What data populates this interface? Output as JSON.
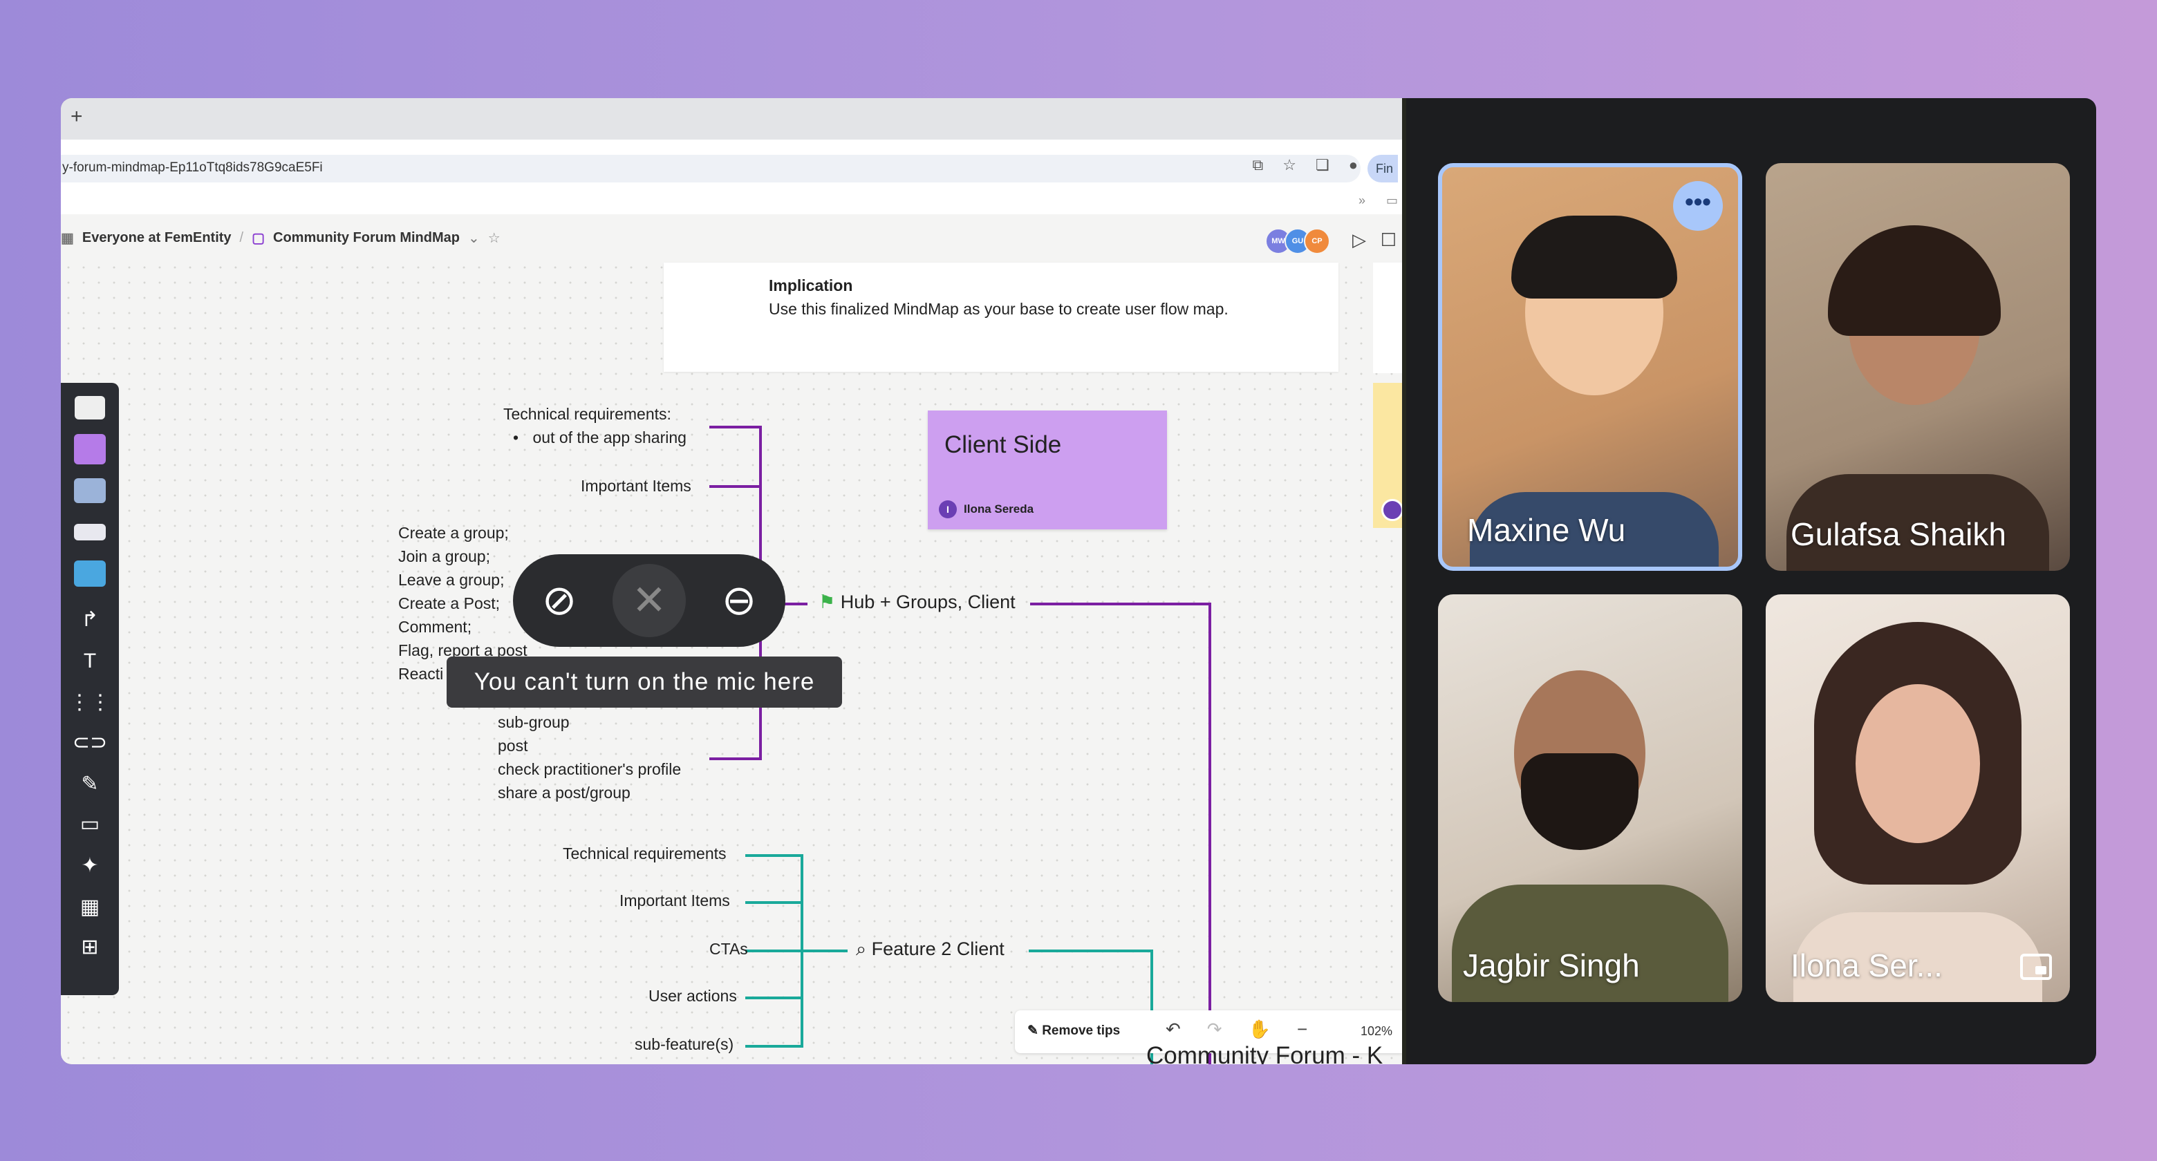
{
  "browser": {
    "new_tab": "+",
    "url": "y-forum-mindmap-Ep11oTtq8ids78G9caE5Fi",
    "profile_label": "Fin"
  },
  "header": {
    "workspace": "Everyone at FemEntity",
    "board": "Community Forum MindMap",
    "avatars": [
      "MW",
      "GU",
      "CP"
    ]
  },
  "info_card": {
    "title": "Implication",
    "text": "Use this finalized MindMap as your base to create user flow map."
  },
  "sticky": {
    "title": "Client Side",
    "author": "Ilona Sereda",
    "author_initial": "I"
  },
  "mindmap": {
    "group1": {
      "tech_req": "Technical requirements:",
      "tech_bullet": "out of the app sharing",
      "important": "Important Items",
      "actions": [
        "Create a group;",
        "Join a group;",
        "Leave a group;",
        "Create a Post;",
        "Comment;",
        "Flag, report a post",
        "Reacti"
      ],
      "items": [
        "sub-group",
        "post",
        "check practitioner's profile",
        "share a post/group"
      ],
      "hub": "Hub + Groups, Client"
    },
    "group2": {
      "items": [
        "Technical requirements",
        "Important Items",
        "CTAs",
        "User actions",
        "sub-feature(s)"
      ],
      "feature": "Feature 2 Client"
    },
    "bottom_title": "Community Forum - K"
  },
  "mic_tooltip": "You can't turn on the mic here",
  "bottombar": {
    "remove_tips": "Remove tips",
    "zoom": "102%"
  },
  "participants": [
    {
      "name": "Maxine Wu"
    },
    {
      "name": "Gulafsa Shaikh"
    },
    {
      "name": "Jagbir Singh"
    },
    {
      "name": "Ilona Ser..."
    }
  ],
  "colors": {
    "purple_line": "#7b1fa2",
    "teal_line": "#19a99a",
    "sticky": "#cd9ff0",
    "active_border": "#a8c7fa"
  }
}
